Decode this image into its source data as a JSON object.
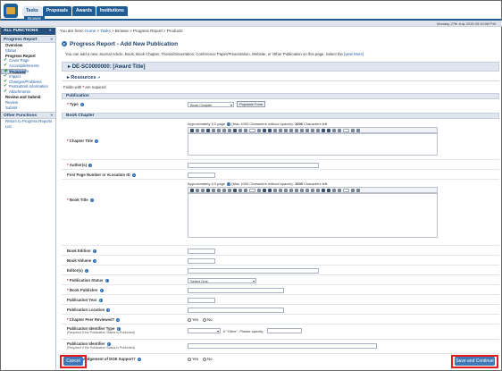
{
  "topnav": {
    "tabs": [
      "Tasks",
      "Proposals",
      "Awards",
      "Institutions"
    ],
    "active_tab": "Tasks",
    "browse_label": "Browse",
    "datetime": "Monday 27th July 2015 05:19:08 P.M."
  },
  "sidebar": {
    "header": "ALL FUNCTIONS",
    "header_toggle": "«",
    "section1": "Progress Report",
    "section1_toggle": "»",
    "items": [
      {
        "label": "Overview",
        "kind": "bold"
      },
      {
        "label": "Status",
        "kind": "link"
      },
      {
        "label": "Progress Report",
        "kind": "bold"
      },
      {
        "label": "Cover Page",
        "kind": "check"
      },
      {
        "label": "Accomplishments",
        "kind": "check"
      },
      {
        "label": "Products",
        "kind": "check-selected"
      },
      {
        "label": "Participants",
        "kind": "check"
      },
      {
        "label": "Impact",
        "kind": "check"
      },
      {
        "label": "Changes/Problems",
        "kind": "check"
      },
      {
        "label": "Postsubmit Information",
        "kind": "check"
      },
      {
        "label": "Attachments",
        "kind": "check"
      },
      {
        "label": "Review and Submit",
        "kind": "bold"
      },
      {
        "label": "Review",
        "kind": "link"
      },
      {
        "label": "Submit",
        "kind": "link"
      }
    ],
    "section2": "Other Functions",
    "section2_toggle": "»",
    "items2": [
      "Return to Progress Reports",
      "List"
    ]
  },
  "breadcrumb": {
    "prefix": "You are here:",
    "parts": [
      "Home",
      "Tasks",
      "Browse",
      "Progress Report",
      "Products"
    ],
    "sep": " > "
  },
  "page": {
    "title": "Progress Report - Add New Publication",
    "intro": "You can add a new Journal Article, Book, Book Chapter, Thesis/Dissertation, Conference Paper/Presentation, Website, or Other Publication on this page. Select the",
    "intro_link": "[view More]",
    "award_title": "DE-SC0000000: [Award Title]",
    "resources": "Resources",
    "required_note_pre": "Fields with",
    "required_note_post": "are required"
  },
  "publication": {
    "section": "Publication",
    "type_label": "Type",
    "type_value": "Book Chapter",
    "populate_button": "Populate Form"
  },
  "book_chapter": {
    "section": "Book Chapter",
    "editor_hint": "Approximately 1/2 page",
    "editor_hint_mid": "(Max 1000 Characters without spaces):",
    "editor_hint_count": "1000",
    "editor_hint_end": "Characters left.",
    "chapter_title": "Chapter Title",
    "authors": "Author(s)",
    "first_page": "First Page Number or eLocation ID",
    "book_title": "Book Title",
    "book_edition": "Book Edition",
    "book_volume": "Book Volume",
    "editors": "Editor(s)",
    "publication_status": "Publication Status",
    "status_value": "Select One",
    "book_publisher": "Book Publisher",
    "publication_year": "Publication Year",
    "publication_location": "Publication Location",
    "peer_reviewed": "Chapter Peer Reviewed?",
    "identifier_type": "Publication Identifier Type",
    "identifier_type_note": "(Required if the Publication Status is Published)",
    "if_other": "If \"Other\", Please specify:",
    "identifier": "Publication Identifier",
    "identifier_note": "(Required if the Publication Status is Published)",
    "acknowledgement": "Acknowledgement of DOE Support?",
    "yes": "Yes",
    "no": "No",
    "font_size": "12pt"
  },
  "actions": {
    "cancel": "Cancel",
    "save": "Save and Continue"
  },
  "colors": {
    "nav_blue": "#205d96",
    "highlight_red": "#e21b1b",
    "required_red": "#c0151b"
  }
}
